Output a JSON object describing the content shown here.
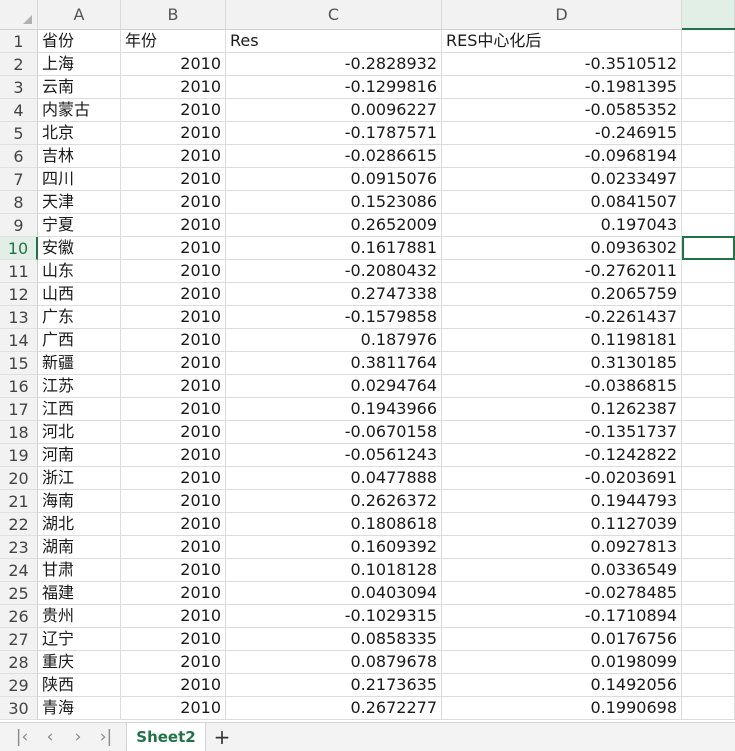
{
  "columns": [
    "A",
    "B",
    "C",
    "D"
  ],
  "header_row": {
    "row": "1",
    "a": "省份",
    "b": "年份",
    "c": "Res",
    "d": "RES中心化后"
  },
  "rows": [
    {
      "row": "2",
      "a": "上海",
      "b": "2010",
      "c": "-0.2828932",
      "d": "-0.3510512"
    },
    {
      "row": "3",
      "a": "云南",
      "b": "2010",
      "c": "-0.1299816",
      "d": "-0.1981395"
    },
    {
      "row": "4",
      "a": "内蒙古",
      "b": "2010",
      "c": "0.0096227",
      "d": "-0.0585352"
    },
    {
      "row": "5",
      "a": "北京",
      "b": "2010",
      "c": "-0.1787571",
      "d": "-0.246915"
    },
    {
      "row": "6",
      "a": "吉林",
      "b": "2010",
      "c": "-0.0286615",
      "d": "-0.0968194"
    },
    {
      "row": "7",
      "a": "四川",
      "b": "2010",
      "c": "0.0915076",
      "d": "0.0233497"
    },
    {
      "row": "8",
      "a": "天津",
      "b": "2010",
      "c": "0.1523086",
      "d": "0.0841507"
    },
    {
      "row": "9",
      "a": "宁夏",
      "b": "2010",
      "c": "0.2652009",
      "d": "0.197043"
    },
    {
      "row": "10",
      "a": "安徽",
      "b": "2010",
      "c": "0.1617881",
      "d": "0.0936302"
    },
    {
      "row": "11",
      "a": "山东",
      "b": "2010",
      "c": "-0.2080432",
      "d": "-0.2762011"
    },
    {
      "row": "12",
      "a": "山西",
      "b": "2010",
      "c": "0.2747338",
      "d": "0.2065759"
    },
    {
      "row": "13",
      "a": "广东",
      "b": "2010",
      "c": "-0.1579858",
      "d": "-0.2261437"
    },
    {
      "row": "14",
      "a": "广西",
      "b": "2010",
      "c": "0.187976",
      "d": "0.1198181"
    },
    {
      "row": "15",
      "a": "新疆",
      "b": "2010",
      "c": "0.3811764",
      "d": "0.3130185"
    },
    {
      "row": "16",
      "a": "江苏",
      "b": "2010",
      "c": "0.0294764",
      "d": "-0.0386815"
    },
    {
      "row": "17",
      "a": "江西",
      "b": "2010",
      "c": "0.1943966",
      "d": "0.1262387"
    },
    {
      "row": "18",
      "a": "河北",
      "b": "2010",
      "c": "-0.0670158",
      "d": "-0.1351737"
    },
    {
      "row": "19",
      "a": "河南",
      "b": "2010",
      "c": "-0.0561243",
      "d": "-0.1242822"
    },
    {
      "row": "20",
      "a": "浙江",
      "b": "2010",
      "c": "0.0477888",
      "d": "-0.0203691"
    },
    {
      "row": "21",
      "a": "海南",
      "b": "2010",
      "c": "0.2626372",
      "d": "0.1944793"
    },
    {
      "row": "22",
      "a": "湖北",
      "b": "2010",
      "c": "0.1808618",
      "d": "0.1127039"
    },
    {
      "row": "23",
      "a": "湖南",
      "b": "2010",
      "c": "0.1609392",
      "d": "0.0927813"
    },
    {
      "row": "24",
      "a": "甘肃",
      "b": "2010",
      "c": "0.1018128",
      "d": "0.0336549"
    },
    {
      "row": "25",
      "a": "福建",
      "b": "2010",
      "c": "0.0403094",
      "d": "-0.0278485"
    },
    {
      "row": "26",
      "a": "贵州",
      "b": "2010",
      "c": "-0.1029315",
      "d": "-0.1710894"
    },
    {
      "row": "27",
      "a": "辽宁",
      "b": "2010",
      "c": "0.0858335",
      "d": "0.0176756"
    },
    {
      "row": "28",
      "a": "重庆",
      "b": "2010",
      "c": "0.0879678",
      "d": "0.0198099"
    },
    {
      "row": "29",
      "a": "陕西",
      "b": "2010",
      "c": "0.2173635",
      "d": "0.1492056"
    },
    {
      "row": "30",
      "a": "青海",
      "b": "2010",
      "c": "0.2672277",
      "d": "0.1990698"
    }
  ],
  "selected_row": "10",
  "sheet_tab": "Sheet2",
  "nav_icons": [
    "first-sheet-icon",
    "prev-sheet-icon",
    "next-sheet-icon",
    "last-sheet-icon"
  ],
  "accent_color": "#217346"
}
